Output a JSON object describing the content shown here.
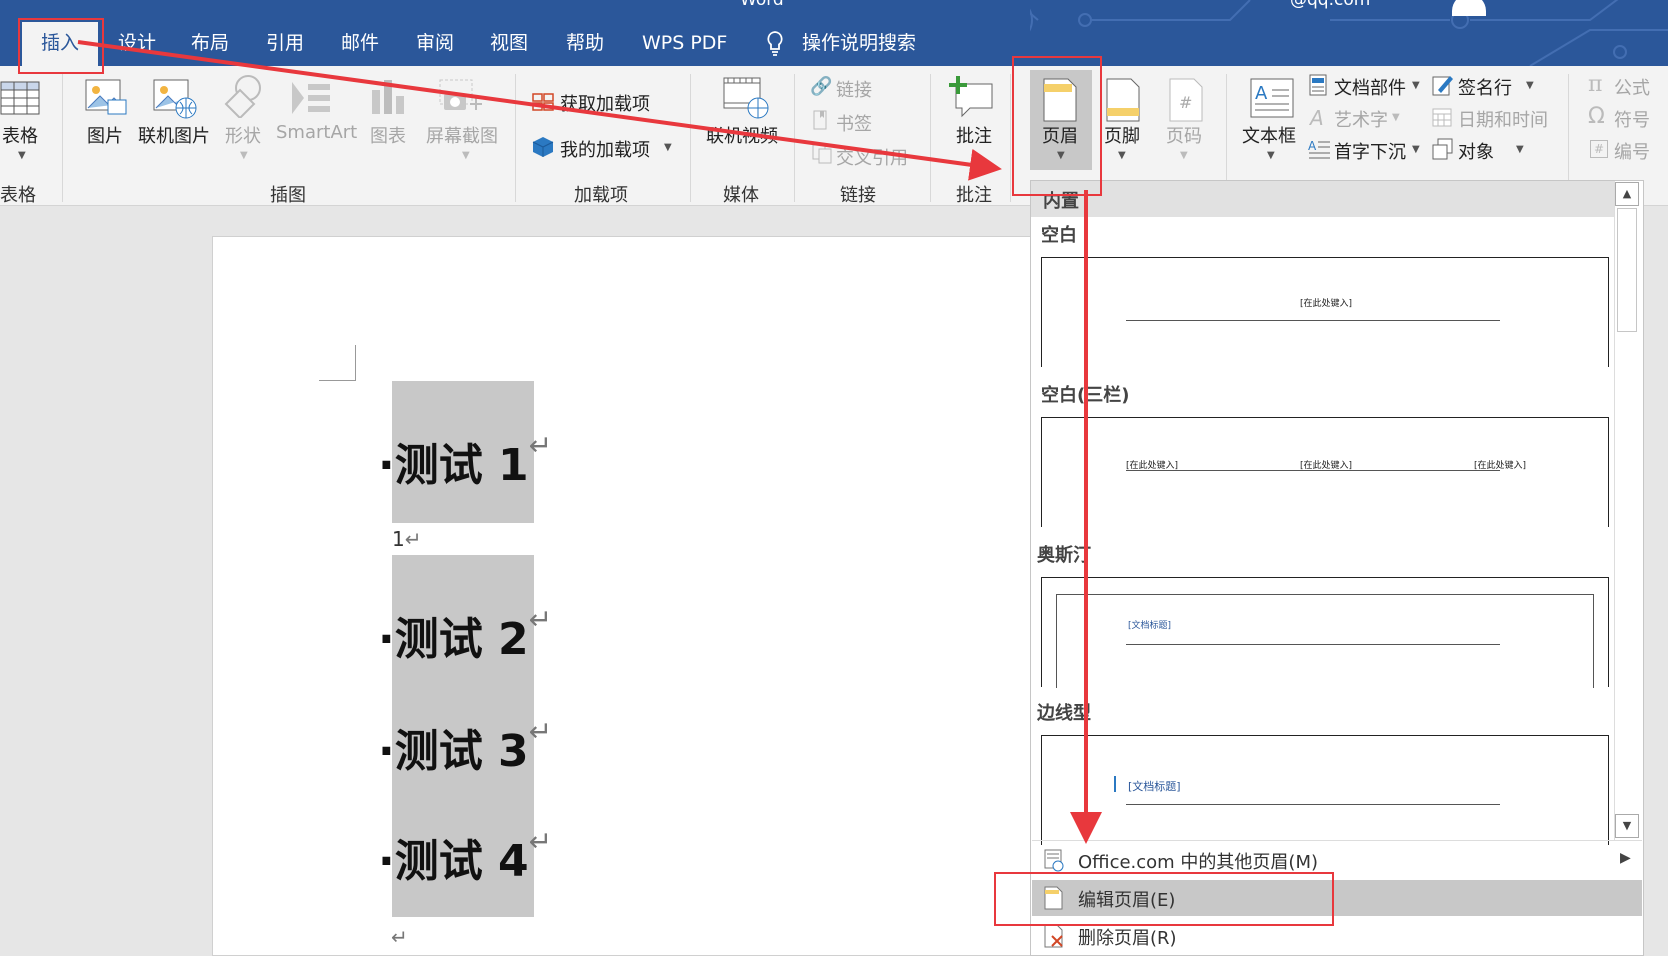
{
  "titlebar": {
    "title_fragment": "Word",
    "email_fragment": "@qq.com",
    "tabs": [
      {
        "label": "插入"
      },
      {
        "label": "设计"
      },
      {
        "label": "布局"
      },
      {
        "label": "引用"
      },
      {
        "label": "邮件"
      },
      {
        "label": "审阅"
      },
      {
        "label": "视图"
      },
      {
        "label": "帮助"
      },
      {
        "label": "WPS PDF"
      }
    ],
    "tell_me": "操作说明搜索"
  },
  "ribbon": {
    "table": {
      "button": "表格",
      "group": "表格"
    },
    "illustrations": {
      "group": "插图",
      "items": [
        "图片",
        "联机图片",
        "形状",
        "SmartArt",
        "图表",
        "屏幕截图"
      ]
    },
    "addins": {
      "group": "加载项",
      "get": "获取加载项",
      "mine": "我的加载项"
    },
    "media": {
      "group": "媒体",
      "online_video": "联机视频"
    },
    "links": {
      "group": "链接",
      "link": "链接",
      "bookmark": "书签",
      "cross_ref": "交叉引用"
    },
    "comments": {
      "group": "批注",
      "comment": "批注"
    },
    "header_footer": {
      "header": "页眉",
      "footer": "页脚",
      "page_number": "页码"
    },
    "text": {
      "textbox": "文本框",
      "quick_parts": "文档部件",
      "wordart": "艺术字",
      "dropcap": "首字下沉",
      "signature": "签名行",
      "datetime": "日期和时间",
      "object": "对象"
    },
    "symbols": {
      "equation": "公式",
      "symbol": "符号",
      "number": "编号"
    }
  },
  "document": {
    "lines": [
      "测试 1",
      "测试 2",
      "测试 3",
      "测试 4"
    ],
    "return_mark": "↵",
    "page_number_line": "1"
  },
  "gallery": {
    "category": "内置",
    "sections": [
      {
        "title": "空白",
        "placeholders": [
          "[在此处键入]"
        ]
      },
      {
        "title": "空白(三栏)",
        "placeholders": [
          "[在此处键入]",
          "[在此处键入]",
          "[在此处键入]"
        ]
      },
      {
        "title": "奥斯汀",
        "placeholders": [
          "[文档标题]"
        ]
      },
      {
        "title": "边线型",
        "placeholders": [
          "[文档标题]"
        ]
      }
    ],
    "menu": [
      {
        "label": "Office.com 中的其他页眉(M)"
      },
      {
        "label": "编辑页眉(E)"
      },
      {
        "label": "删除页眉(R)"
      }
    ]
  },
  "colors": {
    "accent": "#2b579a",
    "annotation": "#e8383d",
    "highlight": "#c8c8c8"
  }
}
